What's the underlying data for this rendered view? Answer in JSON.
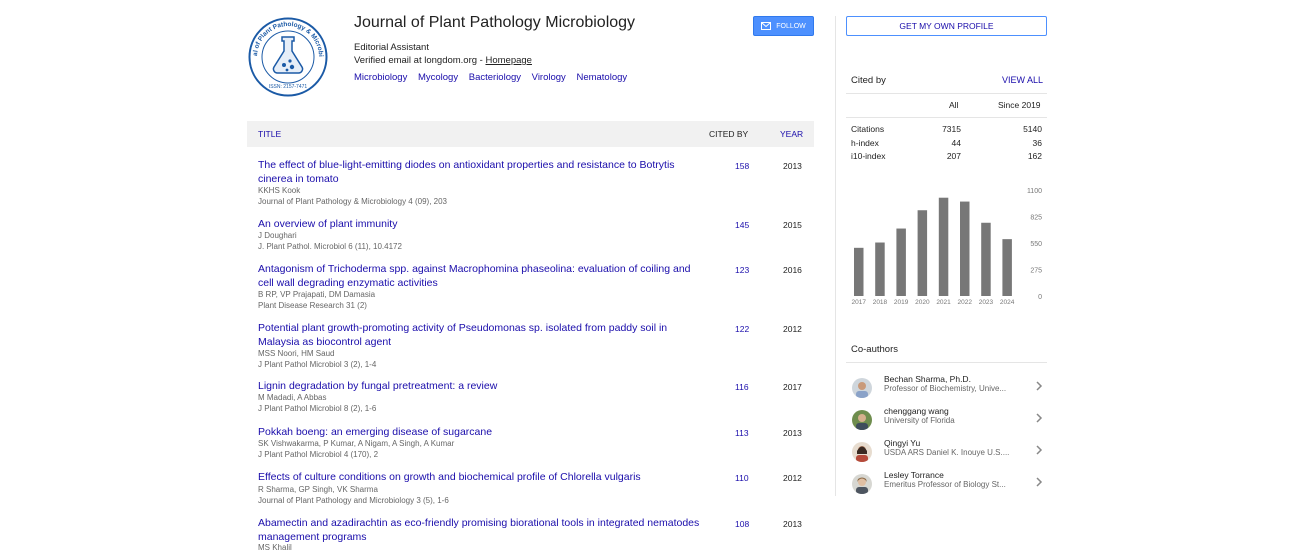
{
  "profile": {
    "logo_text": "Journal of Plant Pathology & Microbiology",
    "logo_issn": "ISSN: 2157-7471",
    "name": "Journal of Plant Pathology Microbiology",
    "affiliation": "Editorial Assistant",
    "email_text": "Verified email at longdom.org - ",
    "homepage_label": "Homepage",
    "interests": [
      "Microbiology",
      "Mycology",
      "Bacteriology",
      "Virology",
      "Nematology"
    ],
    "follow_label": "FOLLOW"
  },
  "table": {
    "headers": {
      "title": "TITLE",
      "cited_by": "CITED BY",
      "year": "YEAR"
    },
    "articles": [
      {
        "title": "The effect of blue-light-emitting diodes on antioxidant properties and resistance to Botrytis cinerea in tomato",
        "authors": "KKHS Kook",
        "venue": "Journal of Plant Pathology & Microbiology 4 (09), 203",
        "cited_by": "158",
        "year": "2013"
      },
      {
        "title": "An overview of plant immunity",
        "authors": "J Doughari",
        "venue": "J. Plant Pathol. Microbiol 6 (11), 10.4172",
        "cited_by": "145",
        "year": "2015"
      },
      {
        "title": "Antagonism of Trichoderma spp. against Macrophomina phaseolina: evaluation of coiling and cell wall degrading enzymatic activities",
        "authors": "B RP, VP Prajapati, DM Damasia",
        "venue": "Plant Disease Research 31 (2)",
        "cited_by": "123",
        "year": "2016"
      },
      {
        "title": "Potential plant growth-promoting activity of Pseudomonas sp. isolated from paddy soil in Malaysia as biocontrol agent",
        "authors": "MSS Noori, HM Saud",
        "venue": "J Plant Pathol Microbiol 3 (2), 1-4",
        "cited_by": "122",
        "year": "2012"
      },
      {
        "title": "Lignin degradation by fungal pretreatment: a review",
        "authors": "M Madadi, A Abbas",
        "venue": "J Plant Pathol Microbiol 8 (2), 1-6",
        "cited_by": "116",
        "year": "2017"
      },
      {
        "title": "Pokkah boeng: an emerging disease of sugarcane",
        "authors": "SK Vishwakarma, P Kumar, A Nigam, A Singh, A Kumar",
        "venue": "J Plant Pathol Microbiol 4 (170), 2",
        "cited_by": "113",
        "year": "2013"
      },
      {
        "title": "Effects of culture conditions on growth and biochemical profile of Chlorella vulgaris",
        "authors": "R Sharma, GP Singh, VK Sharma",
        "venue": "Journal of Plant Pathology and Microbiology 3 (5), 1-6",
        "cited_by": "110",
        "year": "2012"
      },
      {
        "title": "Abamectin and azadirachtin as eco-friendly promising biorational tools in integrated nematodes management programs",
        "authors": "MS Khalil",
        "venue": "",
        "cited_by": "108",
        "year": "2013"
      }
    ]
  },
  "sidebar": {
    "get_profile_label": "GET MY OWN PROFILE",
    "cited_by_label": "Cited by",
    "view_all_label": "VIEW ALL",
    "col_all": "All",
    "col_since": "Since 2019",
    "stats": [
      {
        "label": "Citations",
        "all": "7315",
        "since": "5140"
      },
      {
        "label": "h-index",
        "all": "44",
        "since": "36"
      },
      {
        "label": "i10-index",
        "all": "207",
        "since": "162"
      }
    ],
    "coauthors_label": "Co-authors",
    "coauthors": [
      {
        "name": "Bechan Sharma, Ph.D.",
        "affiliation": "Professor of Biochemistry, Unive..."
      },
      {
        "name": "chenggang wang",
        "affiliation": "University of Florida"
      },
      {
        "name": "Qingyi Yu",
        "affiliation": "USDA ARS Daniel K. Inouye U.S...."
      },
      {
        "name": "Lesley Torrance",
        "affiliation": "Emeritus Professor of Biology St..."
      }
    ]
  },
  "chart_data": {
    "type": "bar",
    "categories": [
      "2017",
      "2018",
      "2019",
      "2020",
      "2021",
      "2022",
      "2023",
      "2024"
    ],
    "values": [
      500,
      555,
      700,
      890,
      1020,
      980,
      760,
      590
    ],
    "title": "",
    "xlabel": "",
    "ylabel": "",
    "yticks": [
      "1100",
      "825",
      "550",
      "275",
      "0"
    ],
    "ylim": [
      0,
      1100
    ],
    "bar_color": "#777777"
  }
}
